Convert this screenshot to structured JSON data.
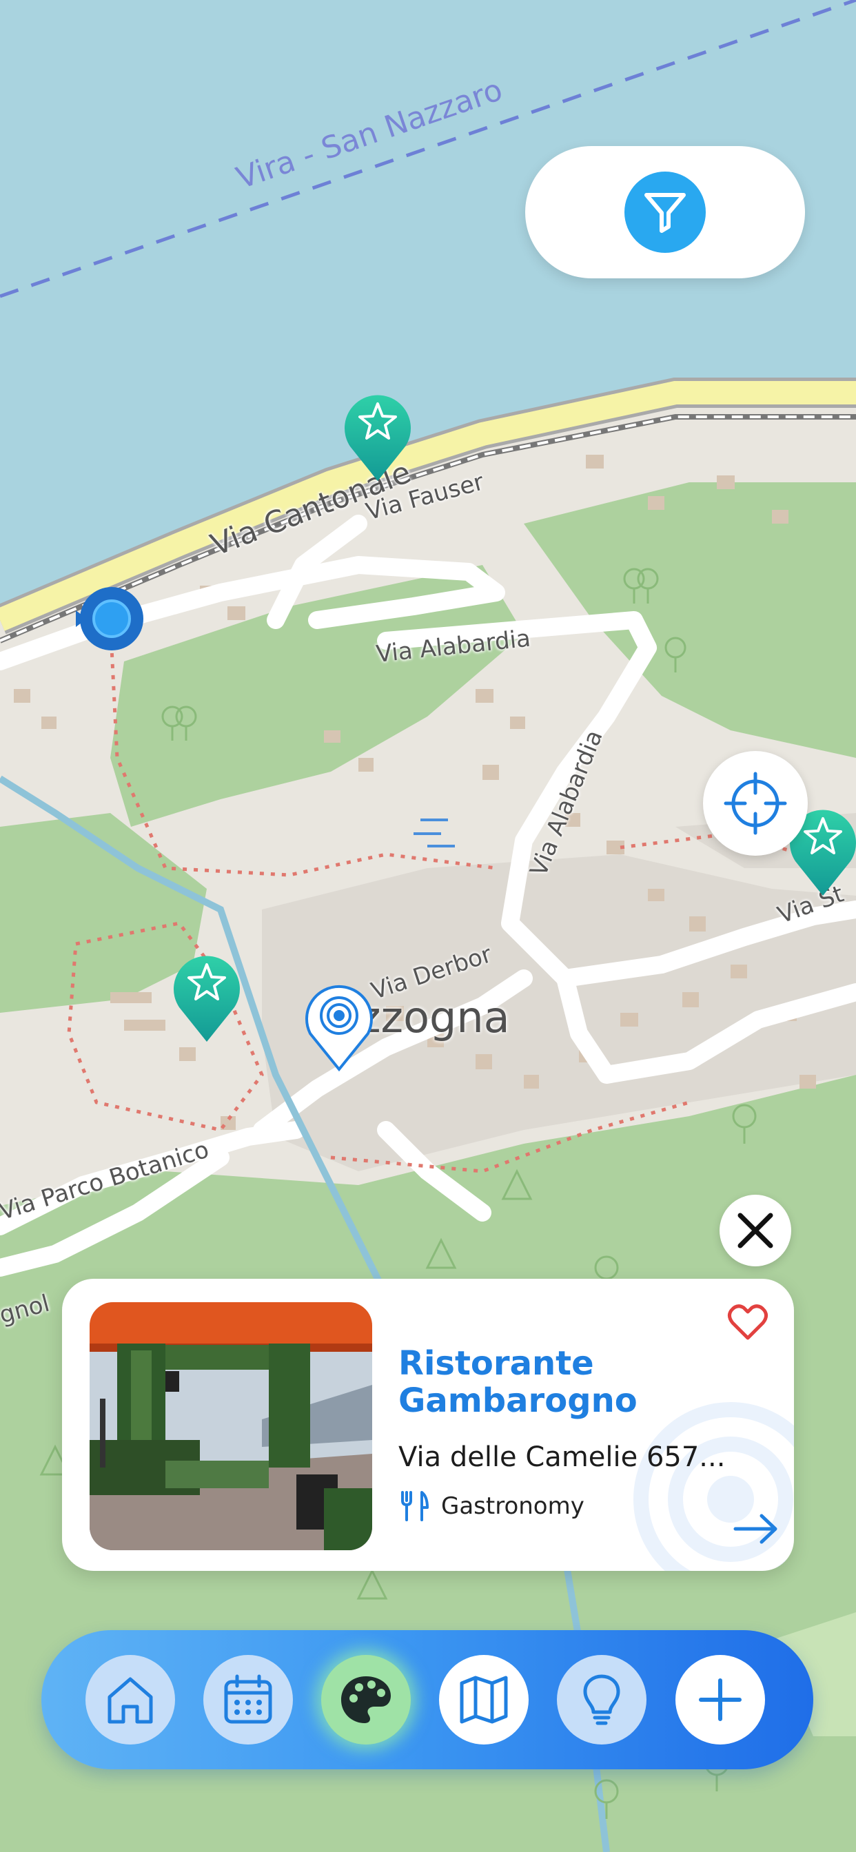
{
  "map": {
    "ferry_label": "Vira - San Nazzaro",
    "place_label": "zzogna",
    "streets": {
      "via_cantonale": "Via Cantonale",
      "via_fauser": "Via Fauser",
      "via_alabardia_1": "Via Alabardia",
      "via_alabardia_2": "Via Alabardia",
      "via_derbor": "Via Derbor",
      "via_parco_botanico": "Via Parco Botanico",
      "via_st": "Via St",
      "gnola": "gnol"
    }
  },
  "markers": {
    "favorite_marker_icon": "star-pin-icon",
    "current_location_icon": "blue-dot-icon",
    "selected_marker_icon": "target-pin-icon"
  },
  "controls": {
    "filter_icon": "filter-icon",
    "locate_icon": "crosshair-icon",
    "close_icon": "close-icon"
  },
  "card": {
    "title": "Ristorante Gambarogno",
    "address": "Via delle Camelie 657...",
    "category": "Gastronomy",
    "category_icon": "fork-knife-icon",
    "favorite_icon": "heart-icon",
    "open_icon": "arrow-right-icon"
  },
  "navbar": {
    "items": [
      {
        "name": "home",
        "icon": "home-icon"
      },
      {
        "name": "calendar",
        "icon": "calendar-icon"
      },
      {
        "name": "culture",
        "icon": "palette-icon"
      },
      {
        "name": "map",
        "icon": "map-icon"
      },
      {
        "name": "ideas",
        "icon": "lightbulb-icon"
      },
      {
        "name": "add",
        "icon": "plus-icon"
      }
    ]
  },
  "colors": {
    "accent": "#1f7fe0",
    "water": "#a9d3df",
    "marker_teal": "#1fb59e",
    "favorite_red": "#e2413f",
    "nav_active": "#9fe2a6"
  }
}
